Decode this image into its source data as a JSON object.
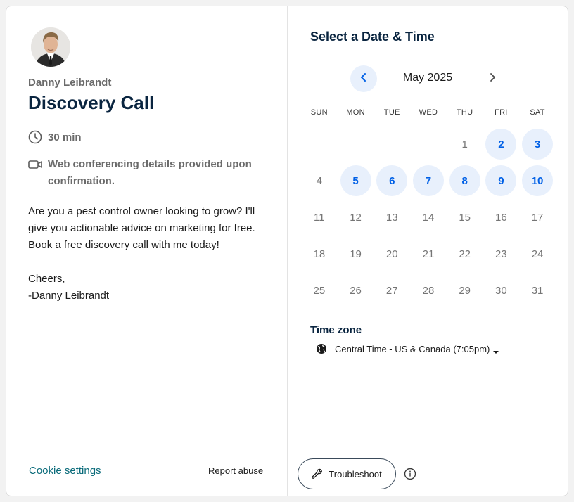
{
  "host": {
    "name": "Danny Leibrandt",
    "avatar_icon": "person-avatar"
  },
  "event": {
    "title": "Discovery Call",
    "duration": "30 min",
    "duration_icon": "clock-icon",
    "conferencing": "Web conferencing details provided upon confirmation.",
    "conferencing_icon": "video-camera-icon",
    "description": [
      "Are you a pest control owner looking to grow? I'll give you actionable advice on marketing for free. Book a free discovery call with me today!",
      "",
      "Cheers,",
      "-Danny Leibrandt"
    ]
  },
  "footer": {
    "cookie_settings": "Cookie settings",
    "report_abuse": "Report abuse"
  },
  "calendar": {
    "heading": "Select a Date & Time",
    "month": "May 2025",
    "weekdays": [
      "SUN",
      "MON",
      "TUE",
      "WED",
      "THU",
      "FRI",
      "SAT"
    ],
    "weeks": [
      [
        null,
        null,
        null,
        null,
        "1",
        "2",
        "3"
      ],
      [
        "4",
        "5",
        "6",
        "7",
        "8",
        "9",
        "10"
      ],
      [
        "11",
        "12",
        "13",
        "14",
        "15",
        "16",
        "17"
      ],
      [
        "18",
        "19",
        "20",
        "21",
        "22",
        "23",
        "24"
      ],
      [
        "25",
        "26",
        "27",
        "28",
        "29",
        "30",
        "31"
      ]
    ],
    "available_days": [
      "2",
      "3",
      "5",
      "6",
      "7",
      "8",
      "9",
      "10"
    ]
  },
  "timezone": {
    "label": "Time zone",
    "value": "Central Time - US & Canada (7:05pm)"
  },
  "actions": {
    "troubleshoot": "Troubleshoot"
  },
  "colors": {
    "accent": "#0060e6",
    "available_bg": "#e8f0fc",
    "title": "#0a2540",
    "link": "#0a6b7a"
  }
}
